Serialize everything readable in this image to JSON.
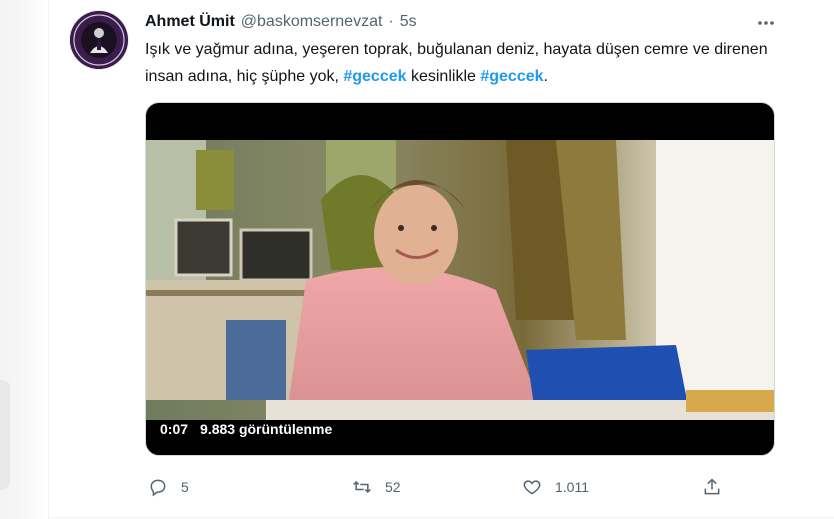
{
  "tweet": {
    "author": {
      "name": "Ahmet Ümit",
      "handle": "@baskomsernevzat",
      "avatar_icon": "avatar-badge-icon"
    },
    "separator": "·",
    "time": "5s",
    "text_parts": {
      "part1": "Işık ve yağmur adına, yeşeren toprak, buğulanan deniz, hayata düşen cemre ve direnen insan adına, hiç şüphe yok, ",
      "hashtag1": "#geccek",
      "part2": " kesinlikle ",
      "hashtag2": "#geccek",
      "part3": "."
    },
    "video": {
      "duration": "0:07",
      "views": "9.883 görüntülenme"
    },
    "actions": {
      "reply": {
        "icon": "reply-icon",
        "count": "5"
      },
      "retweet": {
        "icon": "retweet-icon",
        "count": "52"
      },
      "like": {
        "icon": "heart-icon",
        "count": "1.011"
      },
      "share": {
        "icon": "share-icon"
      }
    },
    "more_icon": "more-icon"
  },
  "colors": {
    "accent": "#1d9bf0",
    "muted": "#536471",
    "text": "#0f1419"
  }
}
